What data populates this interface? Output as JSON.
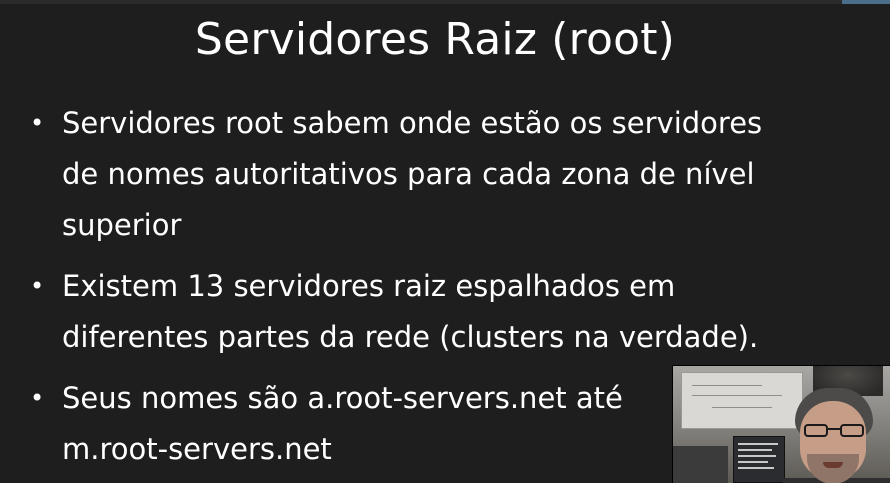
{
  "slide": {
    "title": "Servidores Raiz (root)",
    "bullets": [
      {
        "lines": [
          "Servidores root sabem onde estão os servidores",
          "de nomes autoritativos para cada zona de nível",
          "superior"
        ]
      },
      {
        "lines": [
          "Existem 13 servidores raiz espalhados em",
          "diferentes partes da rede (clusters na verdade)."
        ]
      },
      {
        "lines": [
          "Seus nomes são a.root-servers.net até",
          "m.root-servers.net"
        ]
      }
    ],
    "bullet_glyph": "•"
  },
  "colors": {
    "background": "#1e1e1e",
    "text": "#ffffff"
  },
  "icons": {
    "webcam": "presenter-webcam-overlay"
  }
}
